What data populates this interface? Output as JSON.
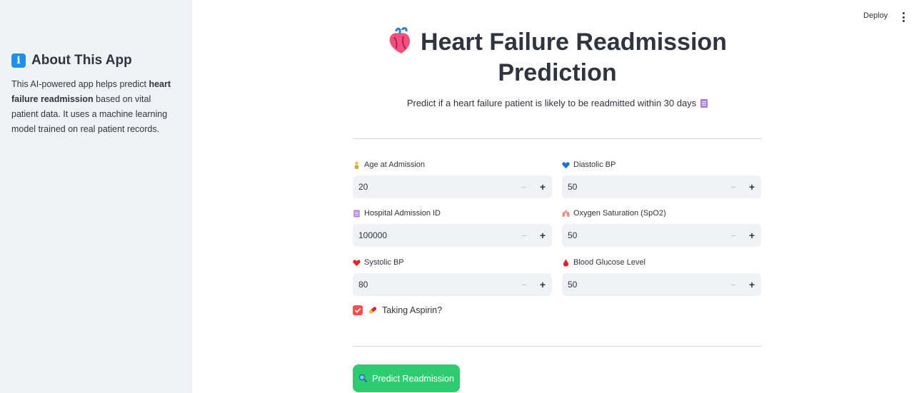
{
  "header": {
    "deploy_label": "Deploy",
    "menu_icon": "kebab-menu-icon"
  },
  "sidebar": {
    "icon": "info-icon",
    "title": "About This App",
    "text_1": "This AI-powered app helps predict ",
    "text_bold": "heart failure readmission",
    "text_2": " based on vital patient data. It uses a machine learning model trained on real patient records."
  },
  "main": {
    "title_line1": "Heart Failure Readmission",
    "title_line2": "Prediction",
    "subtitle": "Predict if a heart failure patient is likely to be readmitted within 30 days"
  },
  "fields": {
    "age": {
      "label": "Age at Admission",
      "value": "20",
      "icon": "person-icon"
    },
    "diastolic": {
      "label": "Diastolic BP",
      "value": "50",
      "icon": "blue-heart-icon"
    },
    "admission_id": {
      "label": "Hospital Admission ID",
      "value": "100000",
      "icon": "clipboard-icon"
    },
    "spo2": {
      "label": "Oxygen Saturation (SpO2)",
      "value": "50",
      "icon": "lungs-icon"
    },
    "systolic": {
      "label": "Systolic BP",
      "value": "80",
      "icon": "red-heart-icon"
    },
    "glucose": {
      "label": "Blood Glucose Level",
      "value": "50",
      "icon": "blood-drop-icon"
    }
  },
  "stepper": {
    "minus": "−",
    "plus": "+"
  },
  "aspirin": {
    "label": "Taking Aspirin?",
    "checked": true,
    "icon": "pill-icon"
  },
  "predict_button": {
    "label": "Predict Readmission",
    "icon": "magnifier-icon"
  },
  "colors": {
    "accent_red": "#ff4b4b",
    "button_green": "#2ecc71",
    "sidebar_bg": "#f0f2f6",
    "input_bg": "#f0f2f6"
  }
}
